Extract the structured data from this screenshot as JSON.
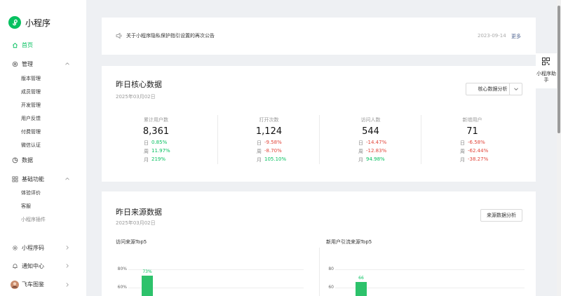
{
  "app": {
    "name": "小程序"
  },
  "sidebar": {
    "home": "首页",
    "manage": "管理",
    "manage_items": [
      "版本管理",
      "成员管理",
      "开发管理",
      "用户反馈",
      "付费管理",
      "微信认证"
    ],
    "data": "数据",
    "basic": "基础功能",
    "basic_items": [
      "体验评价",
      "客服",
      "小程序插件"
    ],
    "mini_code": "小程序码",
    "notify": "通知中心",
    "user_name": "飞车图鉴"
  },
  "notice": {
    "text": "关于小程序隐私保护指引设置的再次公告",
    "date": "2023-09-14",
    "more": "更多"
  },
  "core": {
    "title": "昨日核心数据",
    "date": "2025年03月02日",
    "analysis_button": "核心数据分析",
    "period_labels": [
      "日",
      "周",
      "月"
    ],
    "metrics": [
      {
        "label": "累计用户数",
        "value": "8,361",
        "changes": [
          {
            "v": "0.85%",
            "dir": "up"
          },
          {
            "v": "11.97%",
            "dir": "up"
          },
          {
            "v": "219%",
            "dir": "up"
          }
        ]
      },
      {
        "label": "打开次数",
        "value": "1,124",
        "changes": [
          {
            "v": "-9.58%",
            "dir": "down"
          },
          {
            "v": "-8.70%",
            "dir": "down"
          },
          {
            "v": "105.10%",
            "dir": "up"
          }
        ]
      },
      {
        "label": "访问人数",
        "value": "544",
        "changes": [
          {
            "v": "-14.47%",
            "dir": "down"
          },
          {
            "v": "-12.83%",
            "dir": "down"
          },
          {
            "v": "94.98%",
            "dir": "up"
          }
        ]
      },
      {
        "label": "新增用户",
        "value": "71",
        "changes": [
          {
            "v": "-6.58%",
            "dir": "down"
          },
          {
            "v": "-62.44%",
            "dir": "down"
          },
          {
            "v": "-38.27%",
            "dir": "down"
          }
        ]
      }
    ]
  },
  "source": {
    "title": "昨日来源数据",
    "date": "2025年03月02日",
    "analysis_button": "来源数据分析"
  },
  "chart_data": [
    {
      "type": "bar",
      "title": "访问来源Top5",
      "yticks": [
        "80%",
        "60%"
      ],
      "ylim": [
        0,
        80
      ],
      "values": [
        73
      ],
      "data_labels": [
        "73%"
      ]
    },
    {
      "type": "bar",
      "title": "新用户引流来源Top5",
      "yticks": [
        "80",
        "60"
      ],
      "ylim": [
        0,
        80
      ],
      "values": [
        66
      ],
      "data_labels": [
        "66"
      ]
    }
  ],
  "helper": {
    "label": "小程序助手"
  },
  "colors": {
    "accent": "#07c160",
    "up": "#07c160",
    "down": "#e2463b",
    "link": "#576b95"
  }
}
